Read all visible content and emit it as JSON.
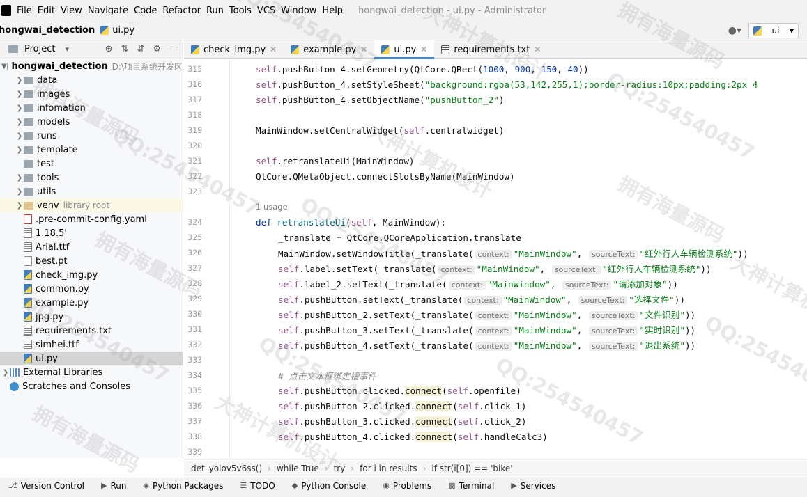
{
  "menubar": {
    "items": [
      "File",
      "Edit",
      "View",
      "Navigate",
      "Code",
      "Refactor",
      "Run",
      "Tools",
      "VCS",
      "Window",
      "Help"
    ],
    "window_title": "hongwai_detection - ui.py - Administrator"
  },
  "navbar": {
    "project": "hongwai_detection",
    "file": "ui.py",
    "run_config": "ui"
  },
  "project_panel": {
    "title": "Project",
    "root_name": "hongwai_detection",
    "root_path": "D:\\项目系统开发区",
    "items": [
      {
        "name": "data",
        "kind": "folder"
      },
      {
        "name": "images",
        "kind": "folder"
      },
      {
        "name": "infomation",
        "kind": "folder"
      },
      {
        "name": "models",
        "kind": "folder"
      },
      {
        "name": "runs",
        "kind": "folder"
      },
      {
        "name": "template",
        "kind": "folder"
      },
      {
        "name": "test",
        "kind": "folder"
      },
      {
        "name": "tools",
        "kind": "folder"
      },
      {
        "name": "utils",
        "kind": "folder"
      },
      {
        "name": "venv",
        "kind": "venv",
        "note": "library root"
      },
      {
        "name": ".pre-commit-config.yaml",
        "kind": "yaml"
      },
      {
        "name": "1.18.5'",
        "kind": "file"
      },
      {
        "name": "Arial.ttf",
        "kind": "file"
      },
      {
        "name": "best.pt",
        "kind": "file"
      },
      {
        "name": "check_img.py",
        "kind": "py"
      },
      {
        "name": "common.py",
        "kind": "py"
      },
      {
        "name": "example.py",
        "kind": "py"
      },
      {
        "name": "jpg.py",
        "kind": "py"
      },
      {
        "name": "requirements.txt",
        "kind": "txt"
      },
      {
        "name": "simhei.ttf",
        "kind": "file"
      },
      {
        "name": "ui.py",
        "kind": "py"
      }
    ],
    "external_libraries": "External Libraries",
    "scratches": "Scratches and Consoles"
  },
  "tabs": [
    {
      "label": "check_img.py",
      "icon": "python-file-icon"
    },
    {
      "label": "example.py",
      "icon": "python-file-icon"
    },
    {
      "label": "ui.py",
      "icon": "python-file-icon",
      "active": true
    },
    {
      "label": "requirements.txt",
      "icon": "text-file-icon"
    }
  ],
  "editor": {
    "usage_hint": "1 usage",
    "line_numbers": [
      "315",
      "316",
      "317",
      "318",
      "319",
      "320",
      "321",
      "322",
      "323",
      "324",
      "325",
      "326",
      "327",
      "328",
      "329",
      "330",
      "331",
      "332",
      "333",
      "334",
      "335",
      "336",
      "337",
      "338",
      "339"
    ]
  },
  "breadcrumb": [
    "det_yolov5v6ss()",
    "while True",
    "try",
    "for i in results",
    "if str(i[0]) == 'bike'"
  ],
  "bottom_toolbar": [
    {
      "label": "Version Control",
      "icon": "version-control-icon"
    },
    {
      "label": "Run",
      "icon": "run-icon"
    },
    {
      "label": "Python Packages",
      "icon": "packages-icon"
    },
    {
      "label": "TODO",
      "icon": "todo-icon"
    },
    {
      "label": "Python Console",
      "icon": "python-console-icon"
    },
    {
      "label": "Problems",
      "icon": "problems-icon"
    },
    {
      "label": "Terminal",
      "icon": "terminal-icon"
    },
    {
      "label": "Services",
      "icon": "services-icon"
    }
  ],
  "watermark": {
    "qq": "QQ:254540457",
    "text_a": "拥有海量源码",
    "text_b": "大神计算机设计"
  },
  "colors": {
    "keyword": "#0033b3",
    "self": "#94558d",
    "string": "#067d17",
    "function": "#00627a",
    "accent": "#4083c9"
  }
}
